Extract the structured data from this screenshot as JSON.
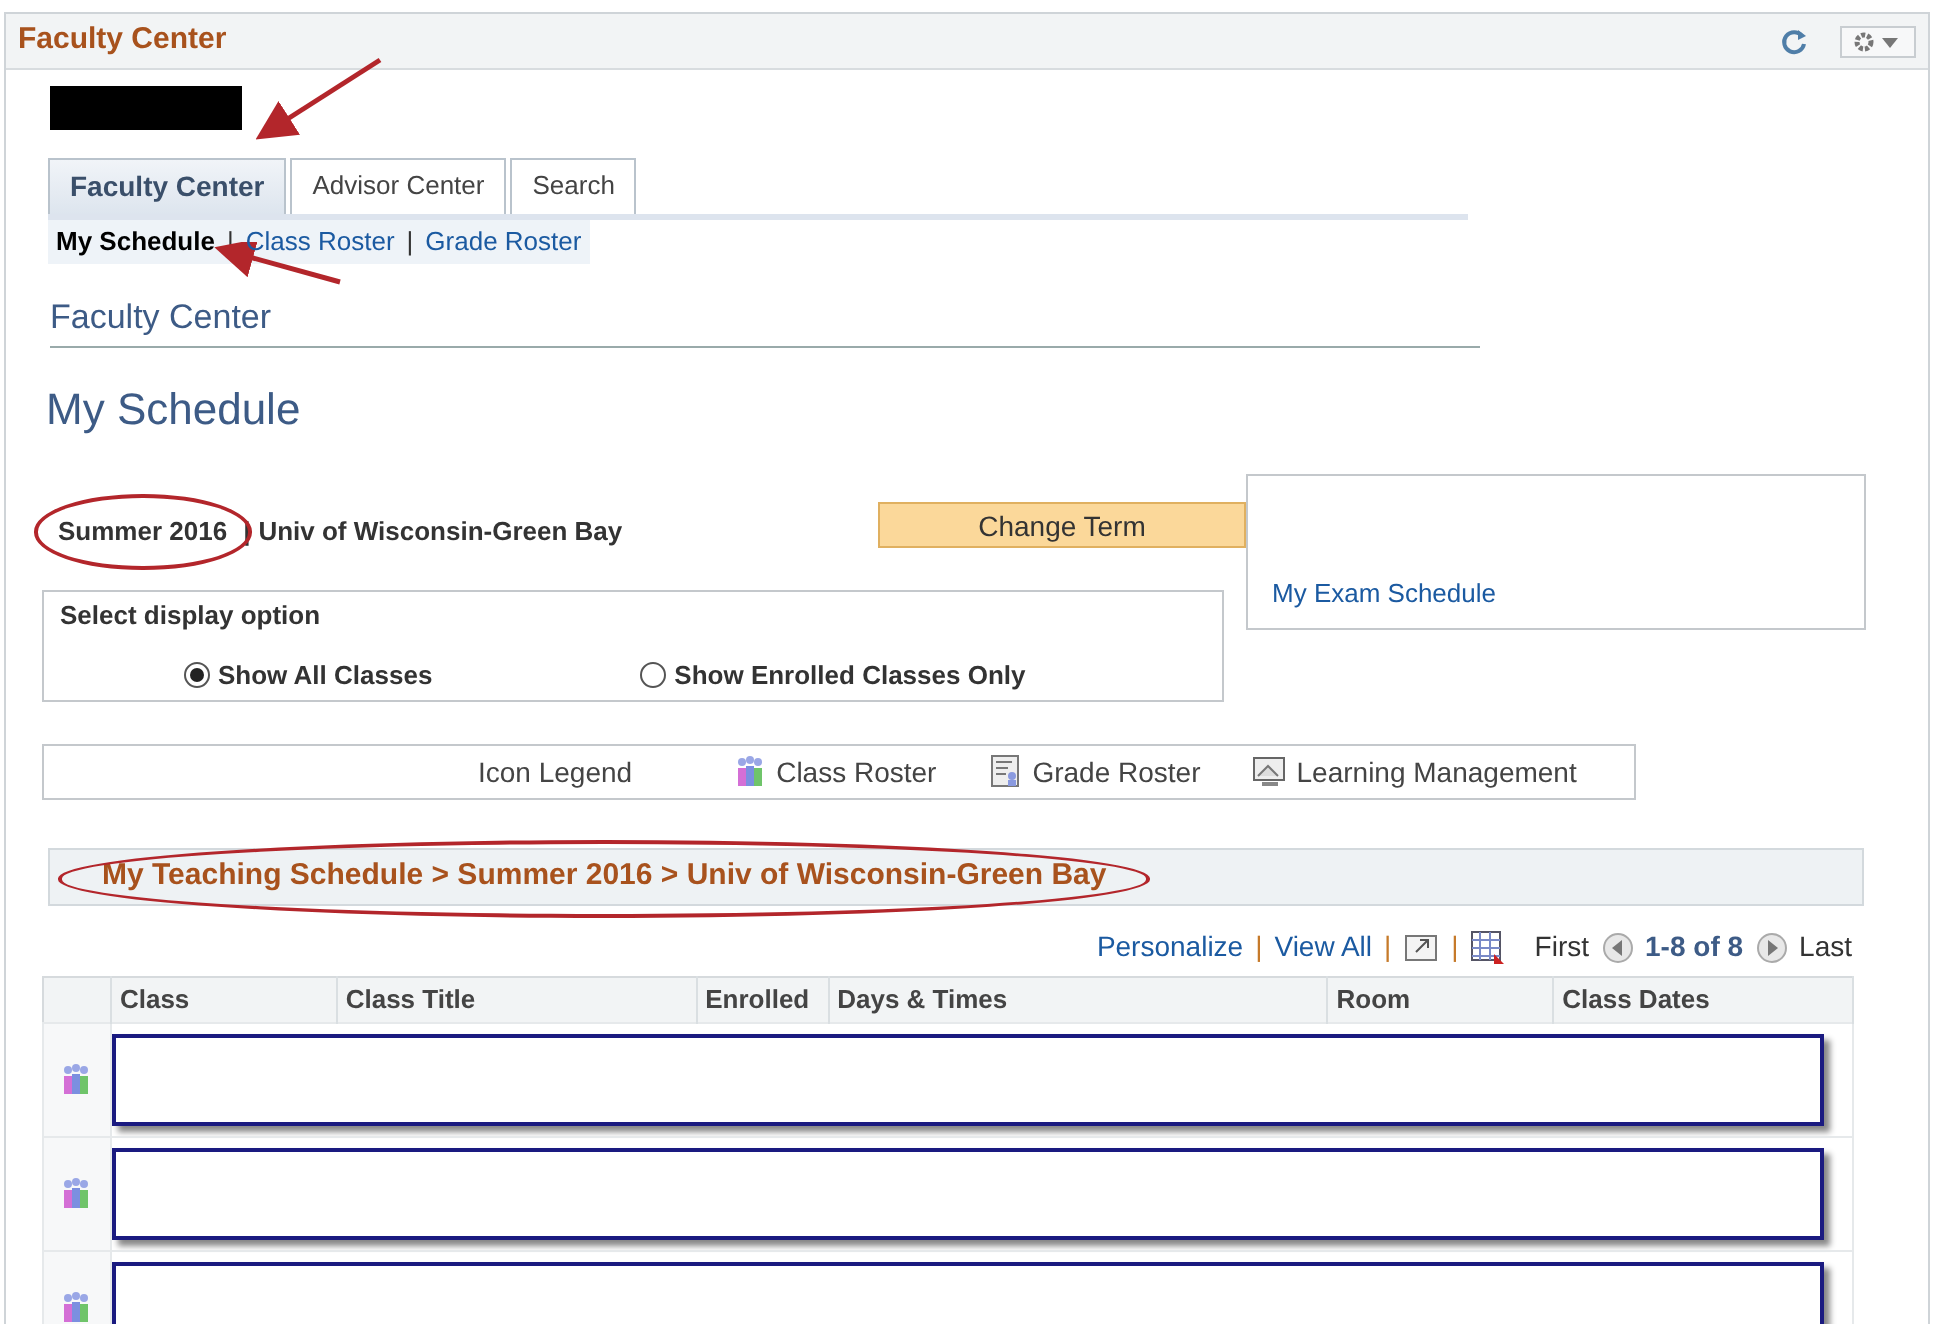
{
  "header": {
    "title": "Faculty Center"
  },
  "tabs": [
    {
      "label": "Faculty Center",
      "selected": true,
      "arrow": true
    },
    {
      "label": "Advisor Center",
      "selected": false
    },
    {
      "label": "Search",
      "selected": false
    }
  ],
  "subnav": [
    {
      "label": "My Schedule",
      "selected": true,
      "arrow": true
    },
    {
      "separator": "|",
      "label": "Class Roster",
      "selected": false
    },
    {
      "separator": "|",
      "label": "Grade Roster",
      "selected": false
    }
  ],
  "section_title": "Faculty Center",
  "page_title": "My Schedule",
  "term": {
    "term": "Summer 2016",
    "circled": true,
    "separator": "|",
    "institution": "Univ of Wisconsin-Green Bay"
  },
  "change_term_button": "Change Term",
  "exam_link": "My Exam Schedule",
  "display_option": {
    "label": "Select display option",
    "options": [
      {
        "label": "Show All Classes",
        "selected": true
      },
      {
        "label": "Show Enrolled Classes Only",
        "selected": false
      }
    ]
  },
  "icon_legend": {
    "label": "Icon Legend",
    "items": [
      {
        "label": "Class Roster",
        "kind": "class-roster"
      },
      {
        "label": "Grade Roster",
        "kind": "grade-roster"
      },
      {
        "label": "Learning Management",
        "kind": "learning"
      }
    ]
  },
  "schedule": {
    "title": "My Teaching Schedule > Summer 2016 > Univ of Wisconsin-Green Bay",
    "circled": true,
    "toolbar": {
      "personalize": "Personalize",
      "separators": [
        "|",
        "|",
        "|"
      ],
      "view_all": "View All",
      "first": "First",
      "range": "1-8 of 8",
      "last": "Last"
    },
    "columns": [
      "Class",
      "Class Title",
      "Enrolled",
      "Days & Times",
      "Room",
      "Class Dates"
    ],
    "rows": [
      {
        "kind": "redacted"
      },
      {
        "kind": "redacted"
      },
      {
        "kind": "redacted"
      }
    ]
  }
}
